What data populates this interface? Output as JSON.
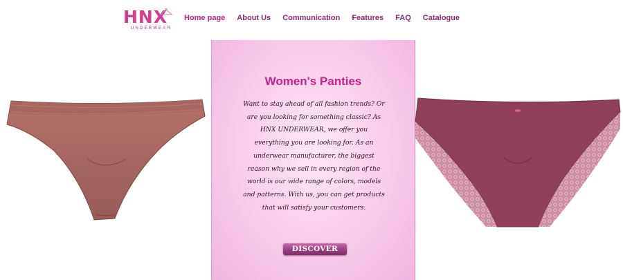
{
  "brand": {
    "name": "HNX",
    "subtitle": "UNDERWEAR",
    "color": "#d63a91"
  },
  "nav": {
    "items": [
      {
        "label": "Home page",
        "active": true
      },
      {
        "label": "About Us"
      },
      {
        "label": "Communication"
      },
      {
        "label": "Features"
      },
      {
        "label": "FAQ"
      },
      {
        "label": "Catalogue"
      }
    ]
  },
  "hero": {
    "title": "Women's Panties",
    "text": "Want to stay ahead of all fashion trends? Or are you looking for something classic? As HNX UNDERWEAR, we offer you everything you are looking for. As an underwear manufacturer, the biggest reason why we sell in every region of the world is our wide range of colors, models and patterns. With us, you can get products that will satisfy your customers.",
    "button_label": "DISCOVER"
  },
  "products": {
    "left_color": "#a86863",
    "right_color": "#8f3f59",
    "lace_color": "#d99ab0"
  }
}
